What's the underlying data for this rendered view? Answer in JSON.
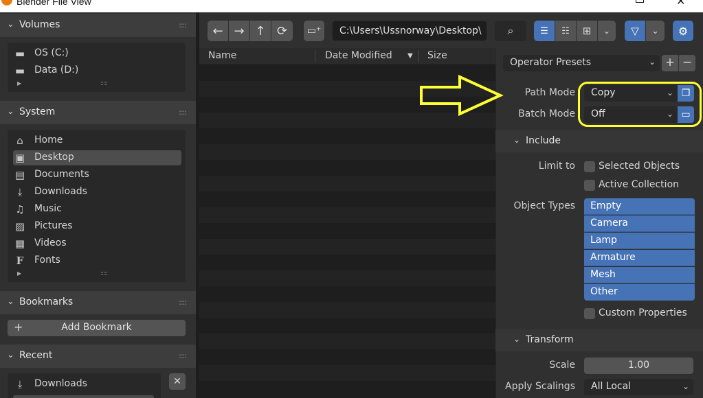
{
  "window": {
    "title": "Blender File View"
  },
  "sidebar": {
    "volumes": {
      "label": "Volumes",
      "items": [
        {
          "label": "OS (C:)",
          "icon": "drive-icon"
        },
        {
          "label": "Data (D:)",
          "icon": "drive-icon"
        }
      ]
    },
    "system": {
      "label": "System",
      "items": [
        {
          "label": "Home",
          "icon": "home-icon"
        },
        {
          "label": "Desktop",
          "icon": "desktop-icon"
        },
        {
          "label": "Documents",
          "icon": "documents-icon"
        },
        {
          "label": "Downloads",
          "icon": "download-icon"
        },
        {
          "label": "Music",
          "icon": "music-icon"
        },
        {
          "label": "Pictures",
          "icon": "picture-icon"
        },
        {
          "label": "Videos",
          "icon": "video-icon"
        },
        {
          "label": "Fonts",
          "icon": "font-icon"
        }
      ],
      "active": "Desktop"
    },
    "bookmarks": {
      "label": "Bookmarks",
      "add_label": "Add Bookmark"
    },
    "recent": {
      "label": "Recent",
      "items": [
        {
          "label": "Downloads",
          "icon": "download-icon"
        }
      ]
    }
  },
  "toolbar": {
    "path": "C:\\Users\\Ussnorway\\Desktop\\"
  },
  "filelist": {
    "columns": [
      "Name",
      "Date Modified",
      "Size"
    ]
  },
  "properties": {
    "presets_label": "Operator Presets",
    "path_mode": {
      "label": "Path Mode",
      "value": "Copy"
    },
    "batch_mode": {
      "label": "Batch Mode",
      "value": "Off"
    },
    "include": {
      "label": "Include",
      "limit_to_label": "Limit to",
      "selected_objects": "Selected Objects",
      "active_collection": "Active Collection",
      "object_types_label": "Object Types",
      "object_types": [
        "Empty",
        "Camera",
        "Lamp",
        "Armature",
        "Mesh",
        "Other"
      ],
      "custom_properties": "Custom Properties"
    },
    "transform": {
      "label": "Transform",
      "scale_label": "Scale",
      "scale_value": "1.00",
      "apply_scalings_label": "Apply Scalings",
      "apply_scalings_value": "All Local"
    }
  },
  "colors": {
    "accent_blue": "#4672b6",
    "annotation_yellow": "#ffff33"
  }
}
